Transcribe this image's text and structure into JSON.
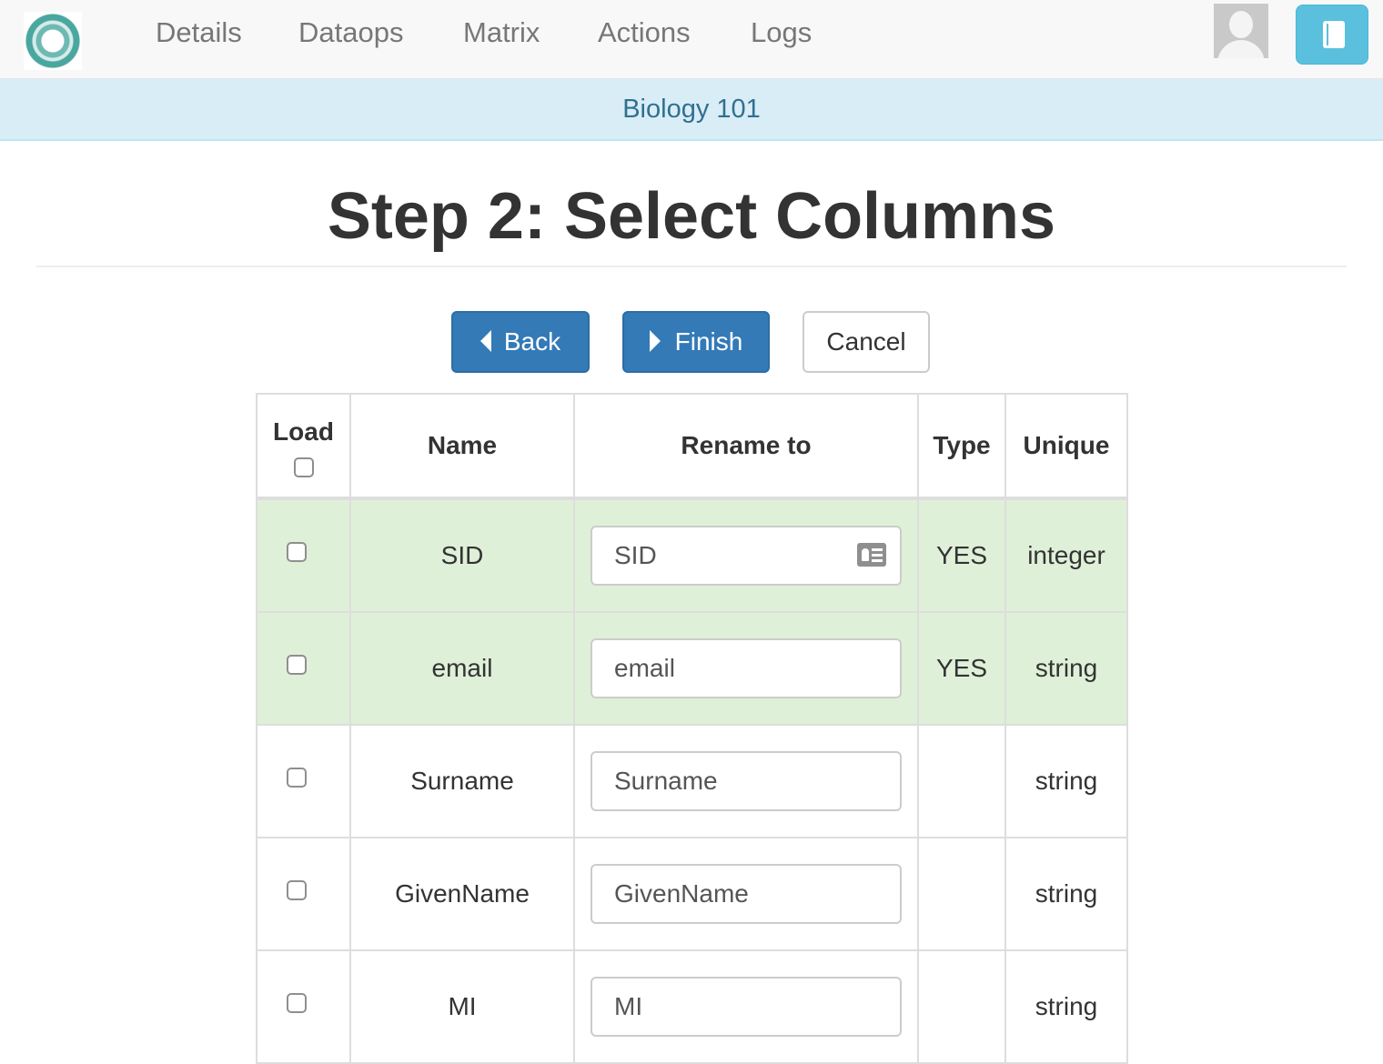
{
  "nav": {
    "links": [
      "Details",
      "Dataops",
      "Matrix",
      "Actions",
      "Logs"
    ]
  },
  "banner": {
    "course": "Biology 101"
  },
  "page": {
    "title": "Step 2: Select Columns"
  },
  "buttons": {
    "back": "Back",
    "finish": "Finish",
    "cancel": "Cancel"
  },
  "table": {
    "headers": {
      "load": "Load",
      "name": "Name",
      "rename": "Rename to",
      "type": "Type",
      "unique": "Unique"
    },
    "rows": [
      {
        "name": "SID",
        "rename": "SID",
        "type": "YES",
        "unique": "integer",
        "highlighted": true,
        "checked": false
      },
      {
        "name": "email",
        "rename": "email",
        "type": "YES",
        "unique": "string",
        "highlighted": true,
        "checked": false
      },
      {
        "name": "Surname",
        "rename": "Surname",
        "type": "",
        "unique": "string",
        "highlighted": false,
        "checked": false
      },
      {
        "name": "GivenName",
        "rename": "GivenName",
        "type": "",
        "unique": "string",
        "highlighted": false,
        "checked": false
      },
      {
        "name": "MI",
        "rename": "MI",
        "type": "",
        "unique": "string",
        "highlighted": false,
        "checked": false
      }
    ]
  },
  "icons": {
    "logo": "ontask-logo-icon",
    "avatar": "user-avatar-icon",
    "book": "book-icon",
    "back": "caret-left-icon",
    "finish": "caret-right-icon",
    "contact": "contact-card-icon"
  },
  "colors": {
    "primary": "#337ab7",
    "info_banner_bg": "#d9edf7",
    "info_banner_text": "#31708f",
    "success_row": "#dff0d8",
    "book_button": "#5bc0de"
  }
}
